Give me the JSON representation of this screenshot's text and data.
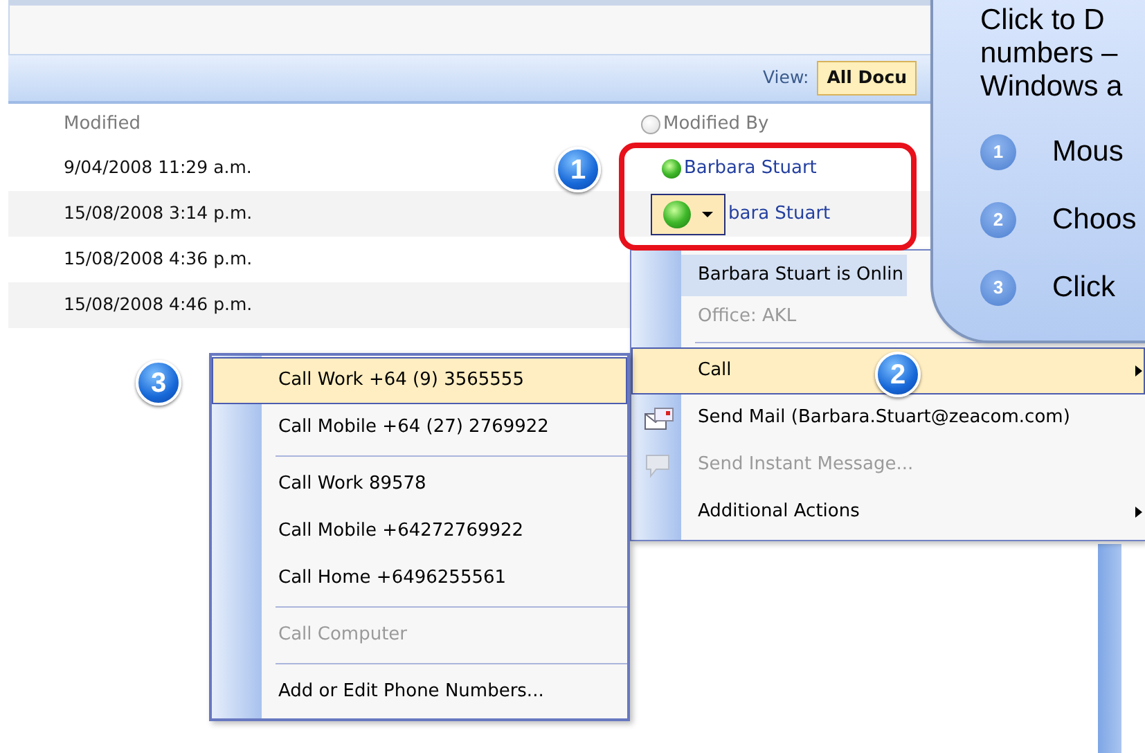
{
  "toolbar": {
    "view_label": "View:",
    "view_value": "All Docu"
  },
  "table": {
    "columns": [
      {
        "label": "Modified"
      },
      {
        "label": "Modified By"
      }
    ],
    "rows": [
      {
        "modified": "9/04/2008 11:29 a.m.",
        "modified_by": "Barbara Stuart",
        "kind": "dot"
      },
      {
        "modified": "15/08/2008 3:14 p.m.",
        "modified_by": "bara Stuart",
        "kind": "menu_button"
      },
      {
        "modified": "15/08/2008 4:36 p.m."
      },
      {
        "modified": "15/08/2008 4:46 p.m."
      }
    ]
  },
  "presence_menu": {
    "items": [
      {
        "kind": "header",
        "label": "Barbara Stuart is Onlin",
        "selected": false,
        "disabled": false
      },
      {
        "kind": "info",
        "label": "Office: AKL",
        "selected": false,
        "disabled": true
      },
      {
        "kind": "separator"
      },
      {
        "kind": "submenu",
        "label": "Call",
        "selected": true,
        "disabled": false
      },
      {
        "kind": "mail",
        "label": "Send Mail (Barbara.Stuart@zeacom.com)",
        "selected": false,
        "disabled": false
      },
      {
        "kind": "message",
        "label": "Send Instant Message...",
        "selected": false,
        "disabled": true
      },
      {
        "kind": "submenu",
        "label": "Additional Actions",
        "selected": false,
        "disabled": false
      }
    ]
  },
  "call_menu": {
    "items": [
      {
        "kind": "item",
        "label": "Call Work +64 (9) 3565555",
        "selected": true,
        "disabled": false
      },
      {
        "kind": "item",
        "label": "Call Mobile +64 (27) 2769922",
        "selected": false,
        "disabled": false
      },
      {
        "kind": "separator"
      },
      {
        "kind": "item",
        "label": "Call Work 89578",
        "selected": false,
        "disabled": false
      },
      {
        "kind": "item",
        "label": "Call Mobile +64272769922",
        "selected": false,
        "disabled": false
      },
      {
        "kind": "item",
        "label": "Call Home +6496255561",
        "selected": false,
        "disabled": false
      },
      {
        "kind": "separator"
      },
      {
        "kind": "item",
        "label": "Call Computer",
        "selected": false,
        "disabled": true
      },
      {
        "kind": "separator"
      },
      {
        "kind": "item",
        "label": "Add or Edit Phone Numbers...",
        "selected": false,
        "disabled": false
      }
    ]
  },
  "callout": {
    "lines": [
      "Click to D",
      "numbers –",
      "Windows a"
    ],
    "steps": [
      {
        "number": "1",
        "text": "Mous"
      },
      {
        "number": "2",
        "text": "Choos"
      },
      {
        "number": "3",
        "text": "Click"
      }
    ]
  },
  "markers": [
    {
      "number": "1"
    },
    {
      "number": "2"
    },
    {
      "number": "3"
    }
  ]
}
